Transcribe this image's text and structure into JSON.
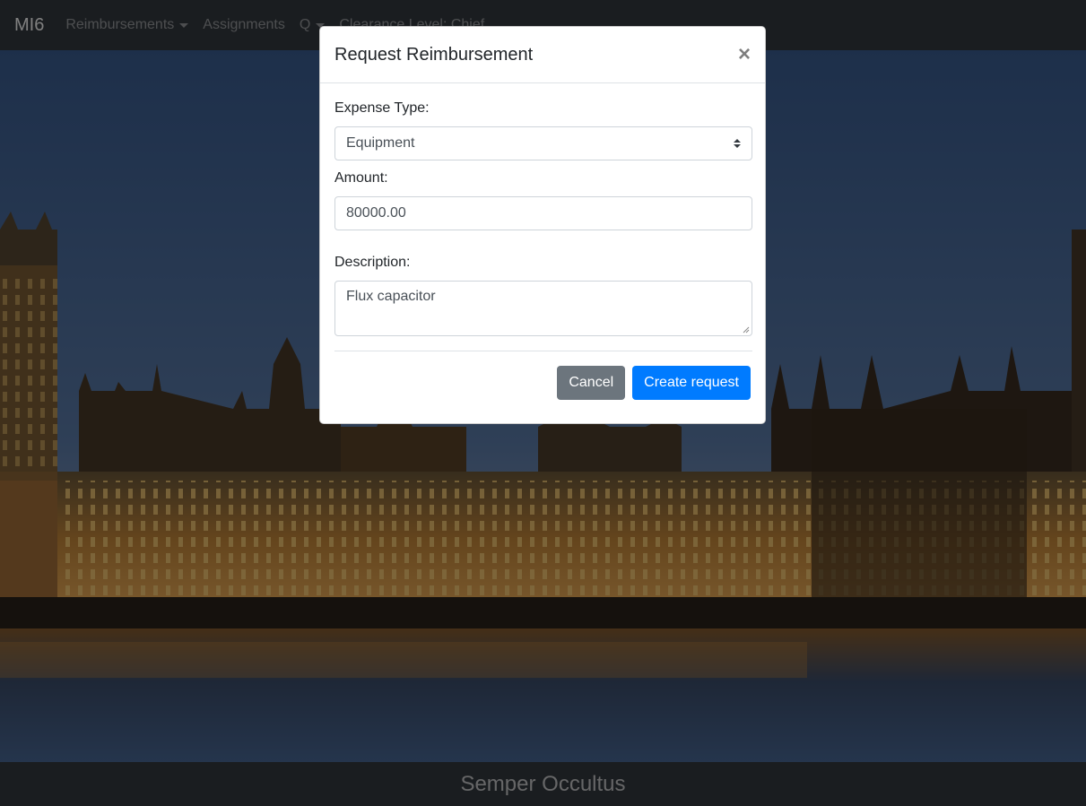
{
  "navbar": {
    "brand": "MI6",
    "items": [
      {
        "label": "Reimbursements"
      },
      {
        "label": "Assignments"
      },
      {
        "label": "Q"
      },
      {
        "label": "Clearance Level: Chief"
      }
    ]
  },
  "footer": {
    "text": "Semper Occultus"
  },
  "modal": {
    "title": "Request Reimbursement",
    "close_label": "×",
    "expense_type_label": "Expense Type:",
    "expense_type_value": "Equipment",
    "amount_label": "Amount:",
    "amount_value": "80000.00",
    "description_label": "Description:",
    "description_value": "Flux capacitor",
    "cancel_label": "Cancel",
    "create_label": "Create request"
  },
  "colors": {
    "navbar_bg": "#343a40",
    "primary": "#007bff",
    "secondary": "#6c757d"
  }
}
